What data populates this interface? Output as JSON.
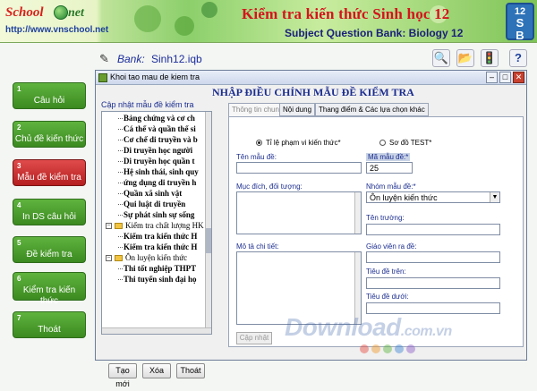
{
  "banner": {
    "logo_school": "School",
    "logo_net": "net",
    "logo_url": "http://www.vnschool.net",
    "title": "Kiểm tra kiến thức Sinh học 12",
    "subtitle": "Subject Question Bank: Biology 12",
    "badge_number": "12",
    "badge_s": "S",
    "badge_b": "B"
  },
  "toolbar": {
    "bank_label": "Bank:",
    "bank_value": "Sinh12.iqb"
  },
  "nav": [
    {
      "num": "1",
      "label": "Câu hỏi"
    },
    {
      "num": "2",
      "label": "Chủ đề kiến thức"
    },
    {
      "num": "3",
      "label": "Mẫu đề kiểm tra"
    },
    {
      "num": "4",
      "label": "In DS câu hỏi"
    },
    {
      "num": "5",
      "label": "Đề kiểm tra"
    },
    {
      "num": "6",
      "label": "Kiểm tra kiến thức"
    },
    {
      "num": "7",
      "label": "Thoát"
    }
  ],
  "window": {
    "title": "Khoi tao mau de kiem tra",
    "heading": "NHẬP ĐIỀU CHỈNH MẪU ĐỀ KIỂM TRA"
  },
  "side": {
    "group_label": "Cập nhật mẫu đề kiểm tra",
    "tree": [
      {
        "text": "Bảng chứng và cơ ch",
        "kind": "sub"
      },
      {
        "text": "Cá thể và quần thể si",
        "kind": "sub"
      },
      {
        "text": "Cơ chế di truyền và b",
        "kind": "sub"
      },
      {
        "text": "Di truyền học người",
        "kind": "sub"
      },
      {
        "text": "Di truyền học quần t",
        "kind": "sub"
      },
      {
        "text": "Hệ sinh thái, sinh quy",
        "kind": "sub"
      },
      {
        "text": "ứng dụng di truyền h",
        "kind": "sub"
      },
      {
        "text": "Quần xã sinh vật",
        "kind": "sub"
      },
      {
        "text": "Qui luật di truyền",
        "kind": "sub"
      },
      {
        "text": "Sự phát sinh sự sống",
        "kind": "sub"
      },
      {
        "text": "Kiểm tra chất lượng HK v",
        "kind": "grp"
      },
      {
        "text": "Kiểm tra kiến thức H",
        "kind": "sub"
      },
      {
        "text": "Kiểm tra kiến thức H",
        "kind": "sub"
      },
      {
        "text": "Ôn luyện kiến thức",
        "kind": "grp"
      },
      {
        "text": "Thi tốt nghiệp THPT",
        "kind": "sub"
      },
      {
        "text": "Thi tuyển sinh đại họ",
        "kind": "sub"
      }
    ],
    "buttons": {
      "new": "Tạo mới",
      "delete": "Xóa",
      "exit": "Thoát"
    }
  },
  "tabs": [
    "Thông tin chung",
    "Nội dung",
    "Thang điểm & Các lựa chọn khác"
  ],
  "form": {
    "radio_ratio": "Tỉ lệ phạm vi kiến thức*",
    "radio_diagram": "Sơ đồ TEST*",
    "name_label": "Tên mẫu đề:",
    "code_label": "Mã mẫu đề:*",
    "code_value": "25",
    "purpose_label": "Mục đích, đối tượng:",
    "group_label": "Nhóm mẫu đề:*",
    "group_value": "Ôn luyện kiến thức",
    "school_label": "Tên trường:",
    "detail_label": "Mô tả chi tiết:",
    "teacher_label": "Giáo viên ra đề:",
    "top_title_label": "Tiêu đề trên:",
    "bottom_title_label": "Tiêu đề dưới:",
    "update_button": "Cập nhật"
  },
  "watermark": {
    "main": "Download",
    "tld": ".com.vn"
  },
  "colors": {
    "accent_red": "#d4141c",
    "nav_green": "#3b8a20",
    "nav_active": "#b51f1f",
    "heading_blue": "#1b2d8f"
  }
}
